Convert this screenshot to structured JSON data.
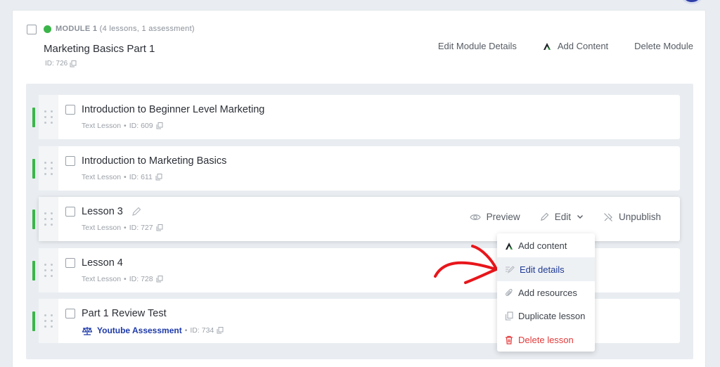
{
  "module": {
    "label": "MODULE 1",
    "counts": "(4 lessons, 1 assessment)",
    "title": "Marketing Basics Part 1",
    "id_text": "ID: 726",
    "status_color": "#3bb54a",
    "actions": {
      "edit_details": "Edit Module Details",
      "add_content": "Add Content",
      "delete": "Delete Module"
    }
  },
  "lessons": [
    {
      "title": "Introduction to Beginner Level Marketing",
      "type": "Text Lesson",
      "sep": "•",
      "id_text": "ID: 609"
    },
    {
      "title": "Introduction to Marketing Basics",
      "type": "Text Lesson",
      "sep": "•",
      "id_text": "ID: 611"
    },
    {
      "title": "Lesson 3",
      "type": "Text Lesson",
      "sep": "•",
      "id_text": "ID: 727"
    },
    {
      "title": "Lesson 4",
      "type": "Text Lesson",
      "sep": "•",
      "id_text": "ID: 728"
    },
    {
      "title": "Part 1 Review Test",
      "type": "Youtube Assessment",
      "sep": "•",
      "id_text": "ID: 734"
    }
  ],
  "row_actions": {
    "preview": "Preview",
    "edit": "Edit",
    "unpublish": "Unpublish"
  },
  "edit_menu": {
    "add_content": "Add content",
    "edit_details": "Edit details",
    "add_resources": "Add resources",
    "duplicate": "Duplicate lesson",
    "delete": "Delete lesson"
  },
  "colors": {
    "status_green": "#3bb54a",
    "accent_blue": "#1e3aa8",
    "danger_red": "#e23b3b",
    "annotation_red": "#e8161b"
  },
  "icons": [
    "copy-icon",
    "brand-a-icon",
    "pencil-icon",
    "eye-icon",
    "chevron-down-icon",
    "unpublish-icon",
    "edit-details-icon",
    "paperclip-icon",
    "trash-icon",
    "scale-icon",
    "drag-handle-icon",
    "annotation-arrow"
  ]
}
